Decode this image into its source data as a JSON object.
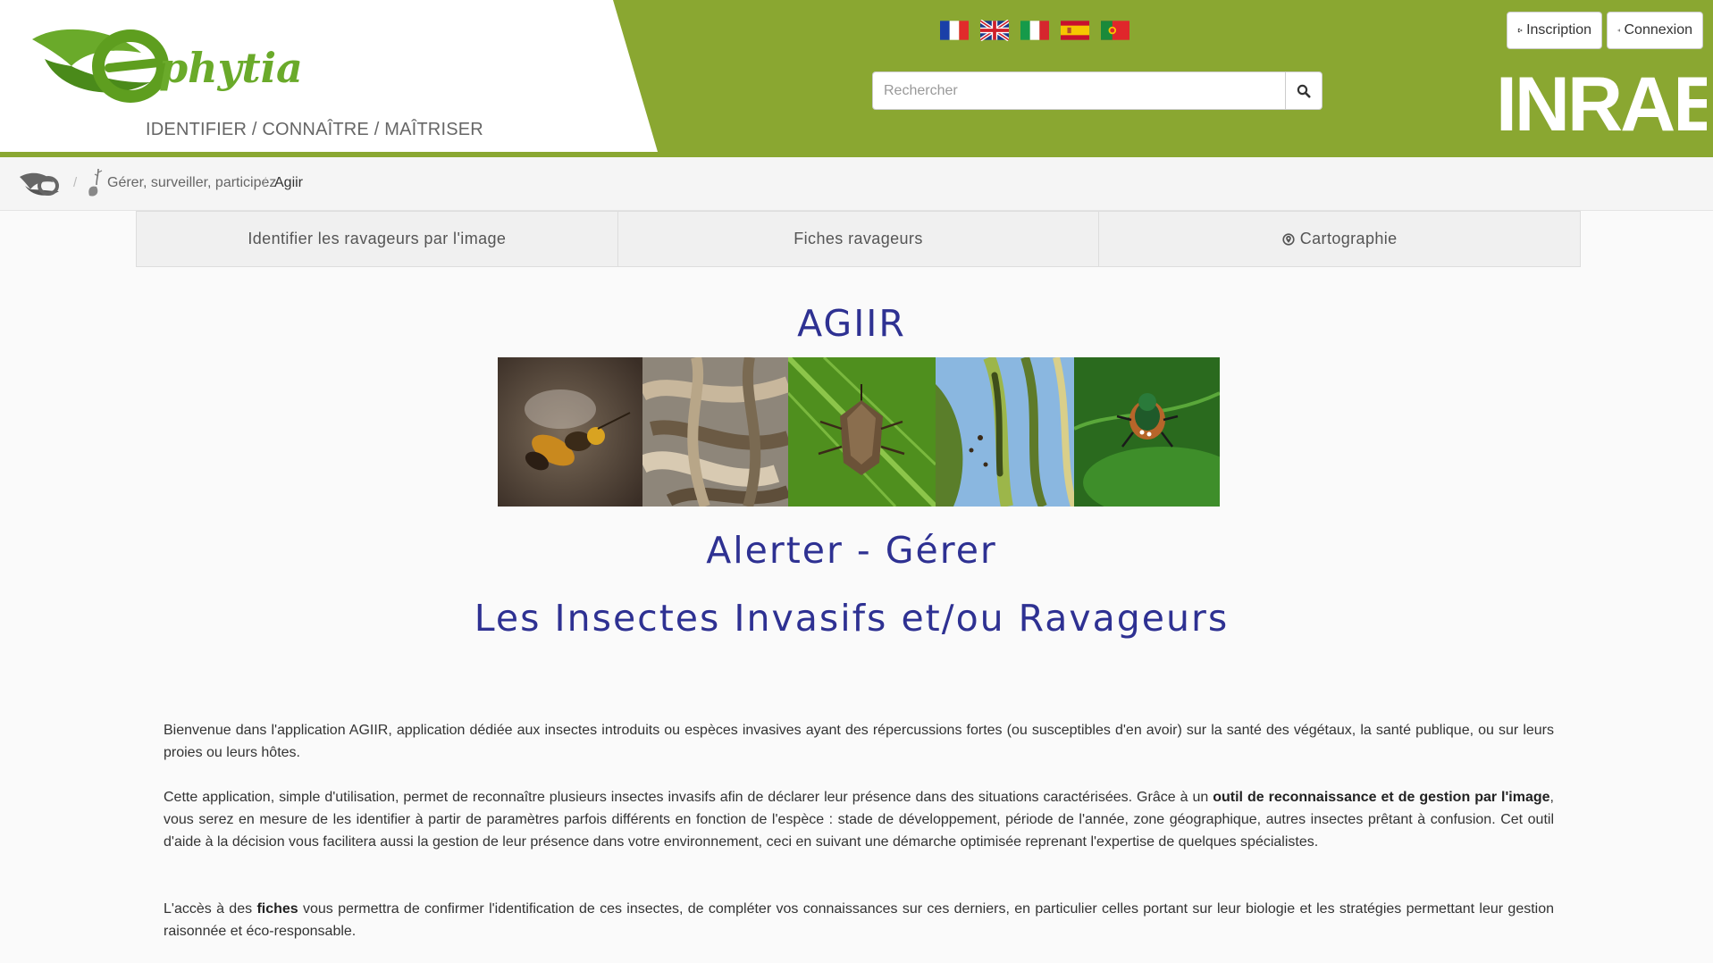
{
  "header": {
    "logo_text": "ephytia",
    "tagline": "IDENTIFIER / CONNAÎTRE / MAÎTRISER",
    "brand_colors": {
      "green": "#8aa731",
      "logo_green": "#5e9e1f",
      "title_blue": "#2e3192"
    },
    "flags": [
      {
        "name": "france-flag",
        "lang": "fr"
      },
      {
        "name": "uk-flag",
        "lang": "en"
      },
      {
        "name": "italy-flag",
        "lang": "it"
      },
      {
        "name": "spain-flag",
        "lang": "es"
      },
      {
        "name": "portugal-flag",
        "lang": "pt"
      }
    ],
    "search": {
      "placeholder": "Rechercher",
      "value": "",
      "icon": "search-icon"
    },
    "inscription_label": "Inscription",
    "connexion_label": "Connexion",
    "partner_logo": "INRAE"
  },
  "breadcrumb": {
    "home_icon": "ephytia-home-icon",
    "section_label": "Gérer, surveiller, participez",
    "separator": "/",
    "current_label": "Agiir"
  },
  "tabs": [
    {
      "label": "Identifier les ravageurs par l'image"
    },
    {
      "label": "Fiches ravageurs"
    },
    {
      "label": "Cartographie",
      "icon": "map-pin-icon"
    }
  ],
  "main": {
    "title": "AGIIR",
    "banner_images": [
      "asian-hornet",
      "caterpillars",
      "stink-bug",
      "leaf-caterpillar",
      "japanese-beetle"
    ],
    "subtitle_line1": "Alerter - Gérer",
    "subtitle_line2": "Les Insectes Invasifs et/ou Ravageurs",
    "p1": "Bienvenue dans l'application AGIIR, application dédiée aux insectes introduits ou espèces invasives ayant des répercussions fortes (ou susceptibles d'en avoir) sur la santé des végétaux, la santé publique, ou sur leurs proies ou leurs hôtes.",
    "p2_a": "Cette application, simple d'utilisation, permet de reconnaître plusieurs insectes invasifs afin de déclarer leur présence dans des situations caractérisées. Grâce à un ",
    "p2_bold": "outil de reconnaissance et de gestion par l'image",
    "p2_b": ", vous serez en mesure de les identifier à partir de paramètres parfois différents en fonction de l'espèce : stade de développement, période de l'année, zone géographique, autres insectes prêtant à confusion. Cet outil d'aide à la décision vous facilitera aussi la gestion de leur présence dans votre environnement, ceci en suivant une démarche optimisée reprenant l'expertise de quelques spécialistes.",
    "p3_a": "L'accès à des ",
    "p3_bold": "fiches",
    "p3_b": " vous permettra  de confirmer l'identification de ces insectes, de compléter vos connaissances sur ces derniers, en particulier celles portant sur leur biologie et les stratégies permettant leur gestion raisonnée et éco-responsable."
  }
}
